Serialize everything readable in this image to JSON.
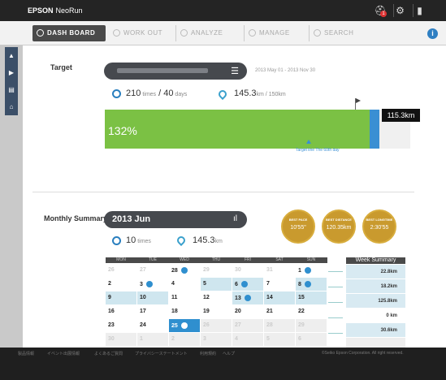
{
  "topbar": {
    "brand": "EPSON",
    "product": "NeoRun",
    "notif": "1"
  },
  "tabs": [
    "DASH BOARD",
    "WORK OUT",
    "ANALYZE",
    "MANAGE",
    "SEARCH"
  ],
  "target": {
    "label": "Target",
    "dates": "2013 May 01 - 2013 Nov 30",
    "times": "210",
    "times_unit": "times",
    "days_sep": "/ 40",
    "days_unit": "days",
    "dist": "145.3",
    "dist_unit": "km / 150",
    "dist_unit2": "km",
    "percent": "132%",
    "km_tag": "115.3km",
    "marker": "Target line The 60th day"
  },
  "monthly": {
    "label": "Monthly Summary",
    "month": "2013 Jun",
    "times": "10",
    "times_unit": "times",
    "dist": "145.3",
    "dist_unit": "km"
  },
  "medals": [
    {
      "title": "BEST PACE",
      "value": "10'55\""
    },
    {
      "title": "BEST DISTANCE",
      "value": "120.35km"
    },
    {
      "title": "BEST LONGTIME",
      "value": "2:30'55"
    }
  ],
  "calendar": {
    "days": [
      "MON",
      "TUE",
      "WED",
      "THU",
      "FRI",
      "SAT",
      "SUN"
    ],
    "rows": [
      [
        "26",
        "27",
        "28",
        "29",
        "30",
        "31",
        "1"
      ],
      [
        "2",
        "3",
        "4",
        "5",
        "6",
        "7",
        "8"
      ],
      [
        "9",
        "10",
        "11",
        "12",
        "13",
        "14",
        "15"
      ],
      [
        "16",
        "17",
        "18",
        "19",
        "20",
        "21",
        "22"
      ],
      [
        "23",
        "24",
        "25",
        "26",
        "27",
        "28",
        "29"
      ],
      [
        "30",
        "1",
        "2",
        "3",
        "4",
        "5",
        "6"
      ]
    ],
    "week_header": "Week Summary",
    "week_values": [
      "22.8km",
      "18.2km",
      "125.8km",
      "0 km",
      "30.6km",
      ""
    ]
  },
  "footer": [
    "製品情報",
    "イベント出展情報",
    "よくあるご質問",
    "プライバシーステートメント",
    "利用規約",
    "ヘルプ",
    "©Seiko Epson Corporation. All right reserved."
  ]
}
